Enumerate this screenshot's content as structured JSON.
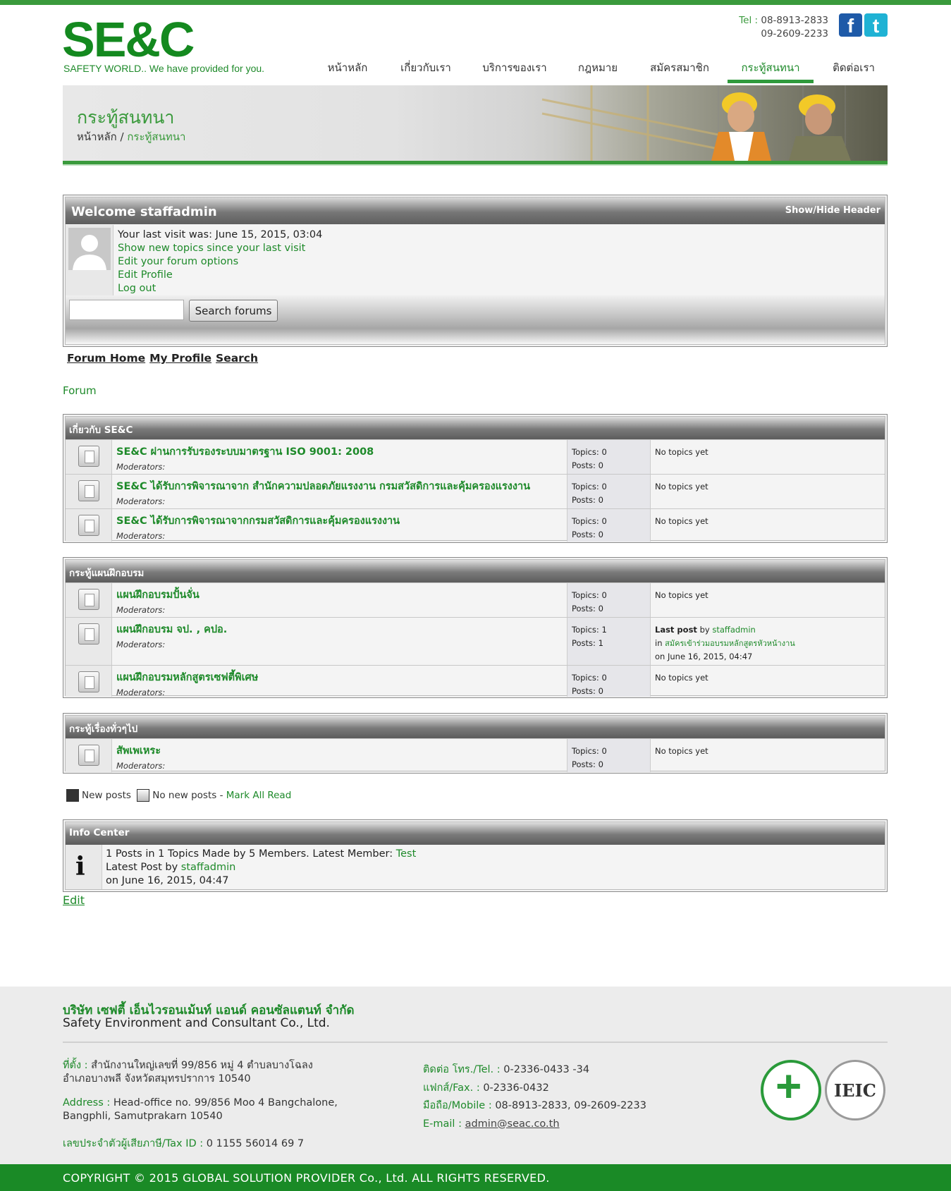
{
  "header": {
    "logo": "SE&C",
    "tagline": "SAFETY WORLD.. We have provided for you.",
    "tel_label": "Tel :",
    "tel1": "08-8913-2833",
    "tel2": "09-2609-2233",
    "social": [
      {
        "icon": "facebook-icon",
        "glyph": "f"
      },
      {
        "icon": "twitter-icon",
        "glyph": "t"
      }
    ]
  },
  "nav": {
    "items": [
      "หน้าหลัก",
      "เกี่ยวกับเรา",
      "บริการของเรา",
      "กฎหมาย",
      "สมัครสมาชิก",
      "กระทู้สนทนา",
      "ติดต่อเรา"
    ],
    "active": "กระทู้สนทนา"
  },
  "banner": {
    "title": "กระทู้สนทนา",
    "crumb_home": "หน้าหลัก",
    "crumb_sep": " / ",
    "crumb_current": "กระทู้สนทนา"
  },
  "welcome": {
    "title": "Welcome staffadmin",
    "show_hide": "Show/Hide Header",
    "last_visit": "Your last visit was: June 15, 2015, 03:04",
    "links": [
      "Show new topics since your last visit",
      "Edit your forum options",
      "Edit Profile",
      "Log out"
    ],
    "search_value": "",
    "search_button": "Search forums"
  },
  "forum_links": [
    "Forum Home",
    "My Profile",
    "Search"
  ],
  "forum_label": "Forum",
  "categories": [
    {
      "title": "เกี่ยวกับ SE&C",
      "forums": [
        {
          "name": "SE&C ผ่านการรับรองระบบมาตรฐาน ISO 9001: 2008",
          "moderators": "Moderators:",
          "topics": "Topics: 0",
          "posts": "Posts: 0",
          "last": "No topics yet"
        },
        {
          "name": "SE&C ได้รับการพิจารณาจาก สำนักความปลอดภัยแรงงาน กรมสวัสดิการและคุ้มครองแรงงาน",
          "moderators": "Moderators:",
          "topics": "Topics: 0",
          "posts": "Posts: 0",
          "last": "No topics yet"
        },
        {
          "name": "SE&C ได้รับการพิจารณาจากกรมสวัสดิการและคุ้มครองแรงงาน",
          "moderators": "Moderators:",
          "topics": "Topics: 0",
          "posts": "Posts: 0",
          "last": "No topics yet"
        }
      ]
    },
    {
      "title": "กระทู้แผนฝึกอบรม",
      "forums": [
        {
          "name": "แผนฝึกอบรมปั้นจั่น",
          "moderators": "Moderators:",
          "topics": "Topics: 0",
          "posts": "Posts: 0",
          "last": "No topics yet"
        },
        {
          "name": "แผนฝึกอบรม จป. , คปอ.",
          "moderators": "Moderators:",
          "topics": "Topics: 1",
          "posts": "Posts: 1",
          "last_post": {
            "label": "Last post",
            "by": "by",
            "author": "staffadmin",
            "in": "in",
            "thread": "สมัครเข้าร่วมอบรมหลักสูตรหัวหน้างาน",
            "date": "on June 16, 2015, 04:47"
          }
        },
        {
          "name": "แผนฝึกอบรมหลักสูตรเซฟตี้พิเศษ",
          "moderators": "Moderators:",
          "topics": "Topics: 0",
          "posts": "Posts: 0",
          "last": "No topics yet"
        }
      ]
    },
    {
      "title": "กระทู้เรื่องทั่วๆไป",
      "forums": [
        {
          "name": "สัพเพเหระ",
          "moderators": "Moderators:",
          "topics": "Topics: 0",
          "posts": "Posts: 0",
          "last": "No topics yet"
        }
      ]
    }
  ],
  "legend": {
    "new_posts": "New posts",
    "no_new_posts": "No new posts",
    "sep": " - ",
    "mark_all": "Mark All Read"
  },
  "info_center": {
    "title": "Info Center",
    "stats": "1 Posts in 1 Topics Made by 5 Members. Latest Member:",
    "latest_member": "Test",
    "latest_post_label": "Latest Post by",
    "latest_post_author": "staffadmin",
    "latest_post_date": "on June 16, 2015, 04:47"
  },
  "edit_link": "Edit",
  "footer": {
    "company_th": "บริษัท เซฟตี้ เอ็นไวรอนเม้นท์ แอนด์ คอนซัลแตนท์ จำกัด",
    "company_en": "Safety Environment and Consultant Co., Ltd.",
    "addr_th_label": "ที่ตั้ง :",
    "addr_th_1": "สำนักงานใหญ่เลขที่ 99/856 หมู่ 4 ตำบลบางโฉลง",
    "addr_th_2": "อำเภอบางพลี จังหวัดสมุทรปราการ 10540",
    "addr_en_label": "Address :",
    "addr_en_1": "Head-office no. 99/856 Moo 4 Bangchalone,",
    "addr_en_2": "Bangphli, Samutprakarn 10540",
    "tax_label": "เลขประจำตัวผู้เสียภาษี/Tax ID :",
    "tax_value": "0 1155 56014 69 7",
    "tel_label": "ติดต่อ โทร./Tel. :",
    "tel_value": "0-2336-0433 -34",
    "fax_label": "แฟกส์/Fax. :",
    "fax_value": "0-2336-0432",
    "mobile_label": "มือถือ/Mobile :",
    "mobile_value": "08-8913-2833, 09-2609-2233",
    "email_label": "E-mail :",
    "email_value": "admin@seac.co.th",
    "seal2_text": "IEIC"
  },
  "copyright": "COPYRIGHT © 2015 GLOBAL SOLUTION PROVIDER Co., Ltd. ALL RIGHTS RESERVED."
}
